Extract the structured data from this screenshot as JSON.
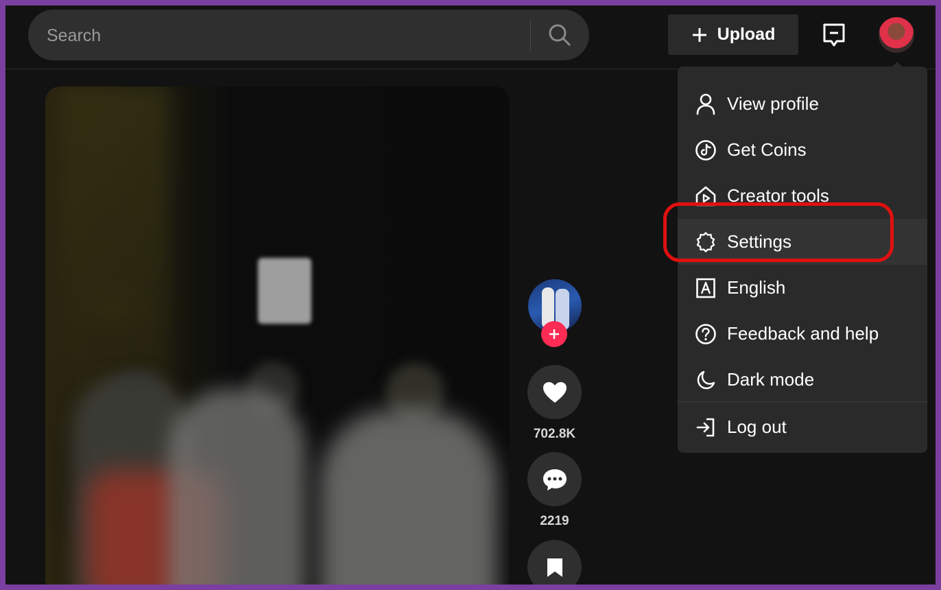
{
  "search": {
    "placeholder": "Search"
  },
  "header": {
    "upload_label": "Upload"
  },
  "video": {
    "like_count": "702.8K",
    "comment_count": "2219"
  },
  "menu": {
    "items": [
      {
        "label": "View profile",
        "icon": "person-icon"
      },
      {
        "label": "Get Coins",
        "icon": "tiktok-coin-icon"
      },
      {
        "label": "Creator tools",
        "icon": "creator-house-icon"
      },
      {
        "label": "Settings",
        "icon": "gear-icon"
      },
      {
        "label": "English",
        "icon": "language-icon"
      },
      {
        "label": "Feedback and help",
        "icon": "help-icon"
      },
      {
        "label": "Dark mode",
        "icon": "moon-icon"
      }
    ],
    "logout_label": "Log out",
    "highlighted_item": "Settings"
  },
  "colors": {
    "accent": "#fe2c55",
    "highlight_ring": "#e01010",
    "frame": "#7b3fa0"
  }
}
